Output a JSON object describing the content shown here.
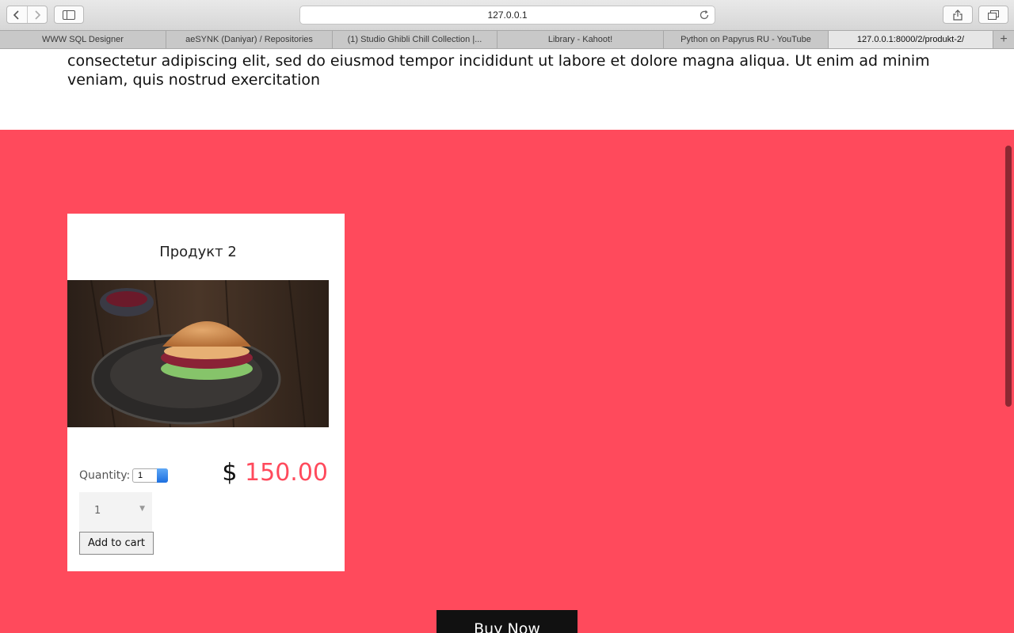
{
  "browser": {
    "address": "127.0.0.1",
    "tabs": [
      {
        "label": "WWW SQL Designer",
        "width": 210
      },
      {
        "label": "aeSYNK (Daniyar) / Repositories",
        "width": 210
      },
      {
        "label": "(1) Studio Ghibli Chill Collection |...",
        "width": 208
      },
      {
        "label": "Library - Kahoot!",
        "width": 210
      },
      {
        "label": "Python on Papyrus RU - YouTube",
        "width": 208
      },
      {
        "label": "127.0.0.1:8000/2/produkt-2/",
        "width": 208
      }
    ],
    "new_tab": "+"
  },
  "page": {
    "intro_text": "consectetur adipiscing elit, sed do eiusmod tempor incididunt ut labore et dolore magna aliqua. Ut enim ad minim veniam, quis nostrud exercitation",
    "product": {
      "title": "Продукт 2",
      "quantity_label": "Quantity:",
      "quantity_value": "1",
      "currency": "$",
      "price": "150.00",
      "dropdown_value": "1",
      "add_to_cart": "Add to cart"
    },
    "buy_now": "Buy Now"
  },
  "colors": {
    "accent": "#ff4a5c"
  }
}
